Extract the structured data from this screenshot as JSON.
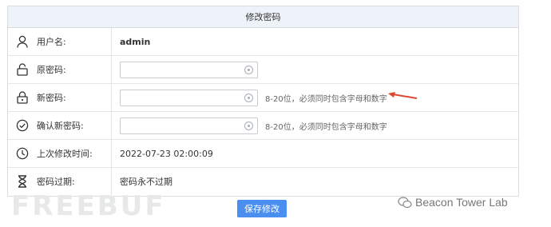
{
  "panel": {
    "title": "修改密码",
    "rows": [
      {
        "icon": "user-icon",
        "label": "用户名:",
        "value": "admin"
      },
      {
        "icon": "lock-open-icon",
        "label": "原密码:",
        "value": ""
      },
      {
        "icon": "lock-icon",
        "label": "新密码:",
        "value": "",
        "hint": "8-20位，必须同时包含字母和数字"
      },
      {
        "icon": "check-circle-icon",
        "label": "确认新密码:",
        "value": "",
        "hint": "8-20位，必须同时包含字母和数字"
      },
      {
        "icon": "clock-icon",
        "label": "上次修改时间:",
        "value": "2022-07-23 02:00:09"
      },
      {
        "icon": "hourglass-icon",
        "label": "密码过期:",
        "value": "密码永不过期"
      }
    ]
  },
  "save_button": "保存修改",
  "watermark_left": "FREEBUF",
  "watermark_right": "Beacon Tower Lab",
  "colors": {
    "header_bg": "#eef3fa",
    "button": "#4a8ff0",
    "arrow": "#e0452e"
  }
}
